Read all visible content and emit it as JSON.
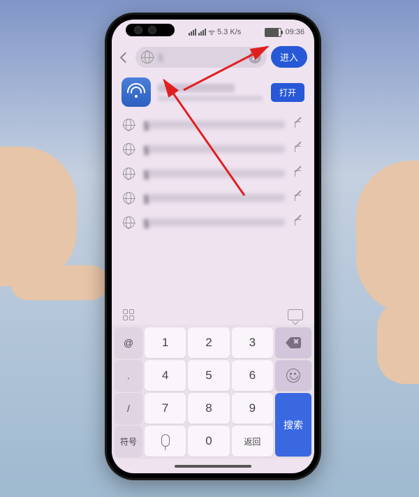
{
  "status_bar": {
    "network_speed": "5.3 K/s",
    "time": "09:36"
  },
  "search": {
    "value": "1",
    "enter_label": "进入"
  },
  "app_suggestion": {
    "open_label": "打开"
  },
  "suggestions": [
    {
      "text": "1"
    },
    {
      "text": "1"
    },
    {
      "text": "1"
    },
    {
      "text": "1"
    },
    {
      "text": "1"
    }
  ],
  "keyboard": {
    "side": [
      "@",
      ".",
      "/",
      "符号"
    ],
    "digits": [
      "1",
      "2",
      "3",
      "4",
      "5",
      "6",
      "7",
      "8",
      "9",
      "0"
    ],
    "period": ".",
    "return_label": "返回",
    "search_label": "搜索",
    "mic_hint": "%"
  }
}
